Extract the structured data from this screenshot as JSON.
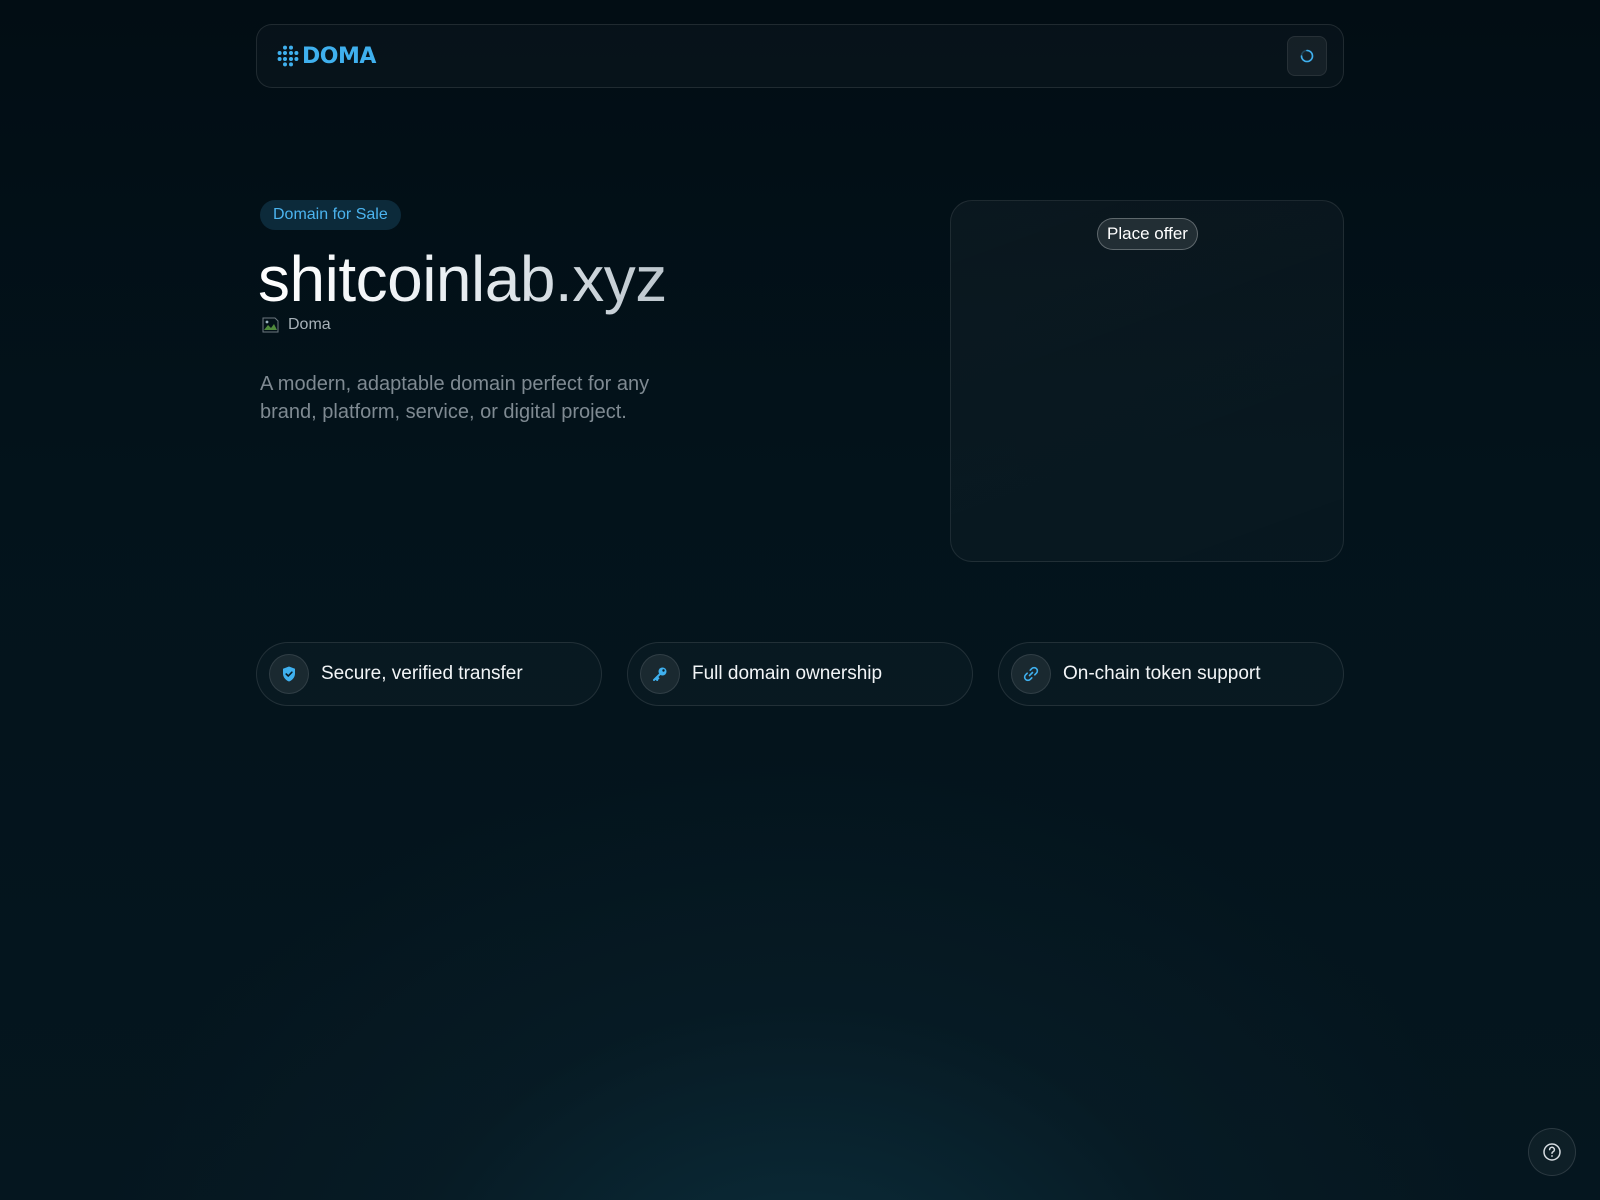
{
  "header": {
    "logo_text": "DOMA",
    "logo_icon": "doma-logo-icon",
    "loading_icon": "loading-spinner-icon"
  },
  "hero": {
    "badge": "Domain for Sale",
    "domain_name": "shitcoinlab.xyz",
    "registrar_name": "Doma",
    "registrar_icon": "broken-image-icon",
    "description": "A modern, adaptable domain perfect for any brand, platform, service, or digital project."
  },
  "offer_card": {
    "button_label": "Place offer"
  },
  "features": [
    {
      "label": "Secure, verified transfer",
      "icon": "shield-check-icon"
    },
    {
      "label": "Full domain ownership",
      "icon": "key-icon"
    },
    {
      "label": "On-chain token support",
      "icon": "link-icon"
    }
  ],
  "help": {
    "icon": "help-circle-icon"
  },
  "colors": {
    "accent": "#3fb0ee",
    "background": "#020d14",
    "text_muted": "#7f8a92"
  }
}
